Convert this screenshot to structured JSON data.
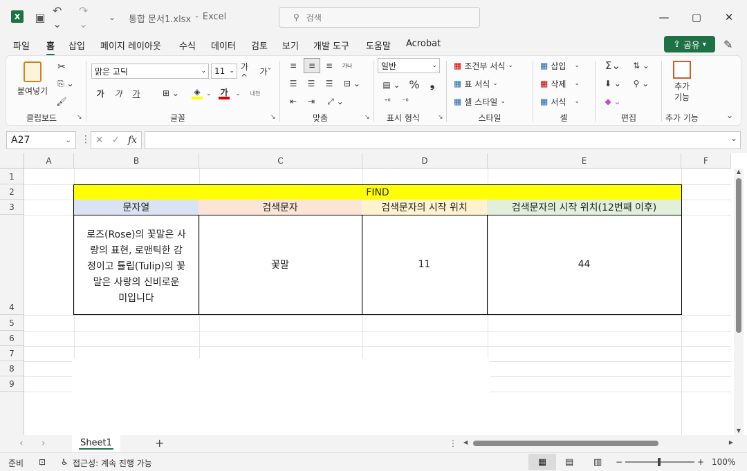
{
  "titlebar": {
    "filename": "통합 문서1.xlsx",
    "separator": "-",
    "app": "Excel",
    "search_placeholder": "검색"
  },
  "menu": {
    "tabs": [
      "파일",
      "홈",
      "삽입",
      "페이지 레이아웃",
      "수식",
      "데이터",
      "검토",
      "보기",
      "개발 도구",
      "도움말",
      "Acrobat"
    ],
    "active_tab": "홈",
    "share": "공유"
  },
  "ribbon": {
    "clipboard": {
      "paste": "붙여넣기",
      "label": "클립보드"
    },
    "font": {
      "name": "맑은 고딕",
      "size": "11",
      "label": "글꼴",
      "bold": "가",
      "italic": "가",
      "underline": "가",
      "color_letter": "가",
      "grow": "가^",
      "shrink": "가ˇ",
      "phonetic": "내천"
    },
    "align": {
      "label": "맞춤",
      "wrap": "가나"
    },
    "number": {
      "format": "일반",
      "label": "표시 형식"
    },
    "styles": {
      "conditional": "조건부 서식",
      "table": "표 서식",
      "cell": "셀 스타일",
      "label": "스타일"
    },
    "cells": {
      "insert": "삽입",
      "delete": "삭제",
      "format": "서식",
      "label": "셀"
    },
    "editing": {
      "label": "편집"
    },
    "addins": {
      "button": "추가 기능",
      "label": "추가 기능"
    }
  },
  "formula_bar": {
    "namebox": "A27",
    "fx": "fx",
    "formula": ""
  },
  "grid": {
    "columns": [
      "A",
      "B",
      "C",
      "D",
      "E",
      "F"
    ],
    "rows": [
      "1",
      "2",
      "3",
      "4",
      "5",
      "6",
      "7",
      "8",
      "9"
    ],
    "title": "FIND",
    "headers": [
      "문자열",
      "검색문자",
      "검색문자의 시작 위치",
      "검색문자의 시작 위치(12번째 이후)"
    ],
    "values": {
      "text_lines": [
        "로즈(Rose)의 꽃말은 사",
        "랑의 표현, 로맨틱한 감",
        "정이고 튤립(Tulip)의 꽃",
        "말은 사랑의 신비로운",
        "미입니다"
      ],
      "search": "꽃말",
      "pos": "11",
      "pos_after": "44"
    },
    "colors": {
      "title": "#ffff00",
      "hdr_b": "#dae3f3",
      "hdr_c": "#fce4d6",
      "hdr_d": "#fff2cc",
      "hdr_e": "#e2efda"
    }
  },
  "sheets": {
    "tabs": [
      "Sheet1"
    ],
    "add": "+"
  },
  "status": {
    "ready": "준비",
    "accessibility": "접근성: 계속 진행 가능",
    "zoom": "100%"
  }
}
